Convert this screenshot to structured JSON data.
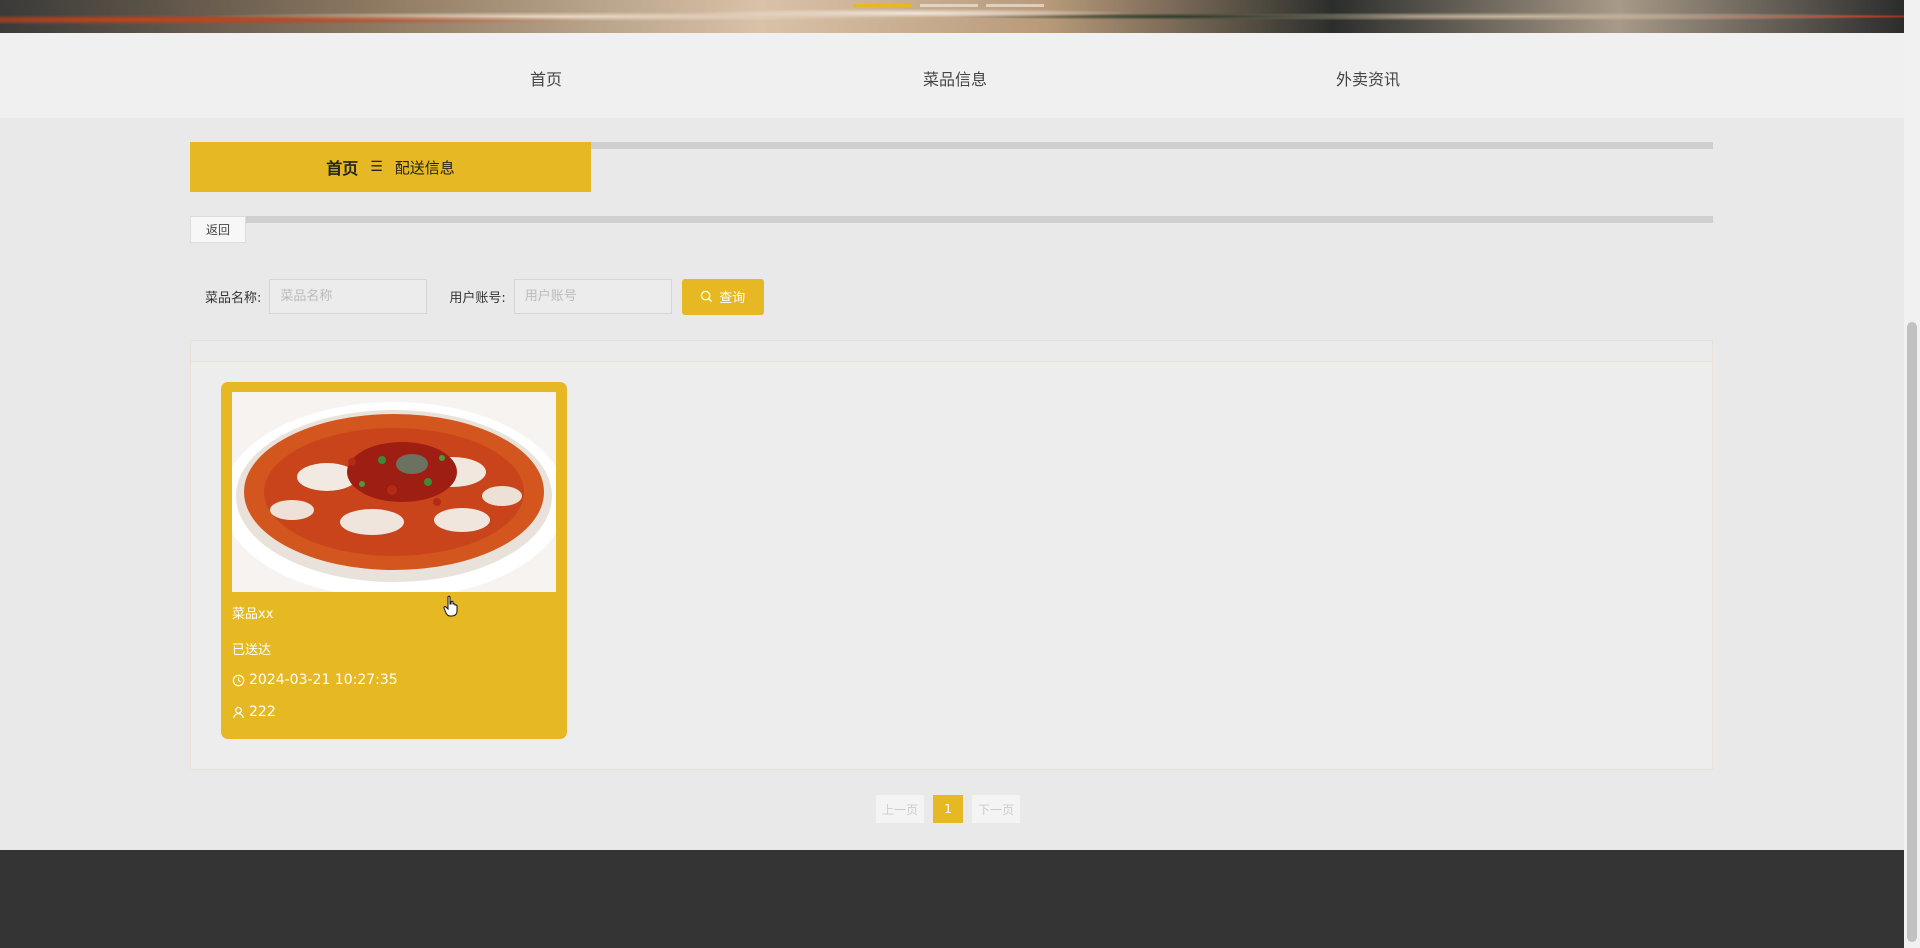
{
  "nav": {
    "items": [
      {
        "label": "首页"
      },
      {
        "label": "菜品信息"
      },
      {
        "label": "外卖资讯"
      }
    ]
  },
  "breadcrumb": {
    "home": "首页",
    "separator": "☰",
    "current": "配送信息"
  },
  "back_button": "返回",
  "search": {
    "dish_label": "菜品名称:",
    "dish_placeholder": "菜品名称",
    "account_label": "用户账号:",
    "account_placeholder": "用户账号",
    "query_label": "查询"
  },
  "cards": [
    {
      "title": "菜品xx",
      "status": "已送达",
      "time": "2024-03-21 10:27:35",
      "user": "222"
    }
  ],
  "pagination": {
    "prev": "上一页",
    "current": "1",
    "next": "下一页"
  },
  "colors": {
    "accent": "#e5b824",
    "footer": "#343434"
  }
}
